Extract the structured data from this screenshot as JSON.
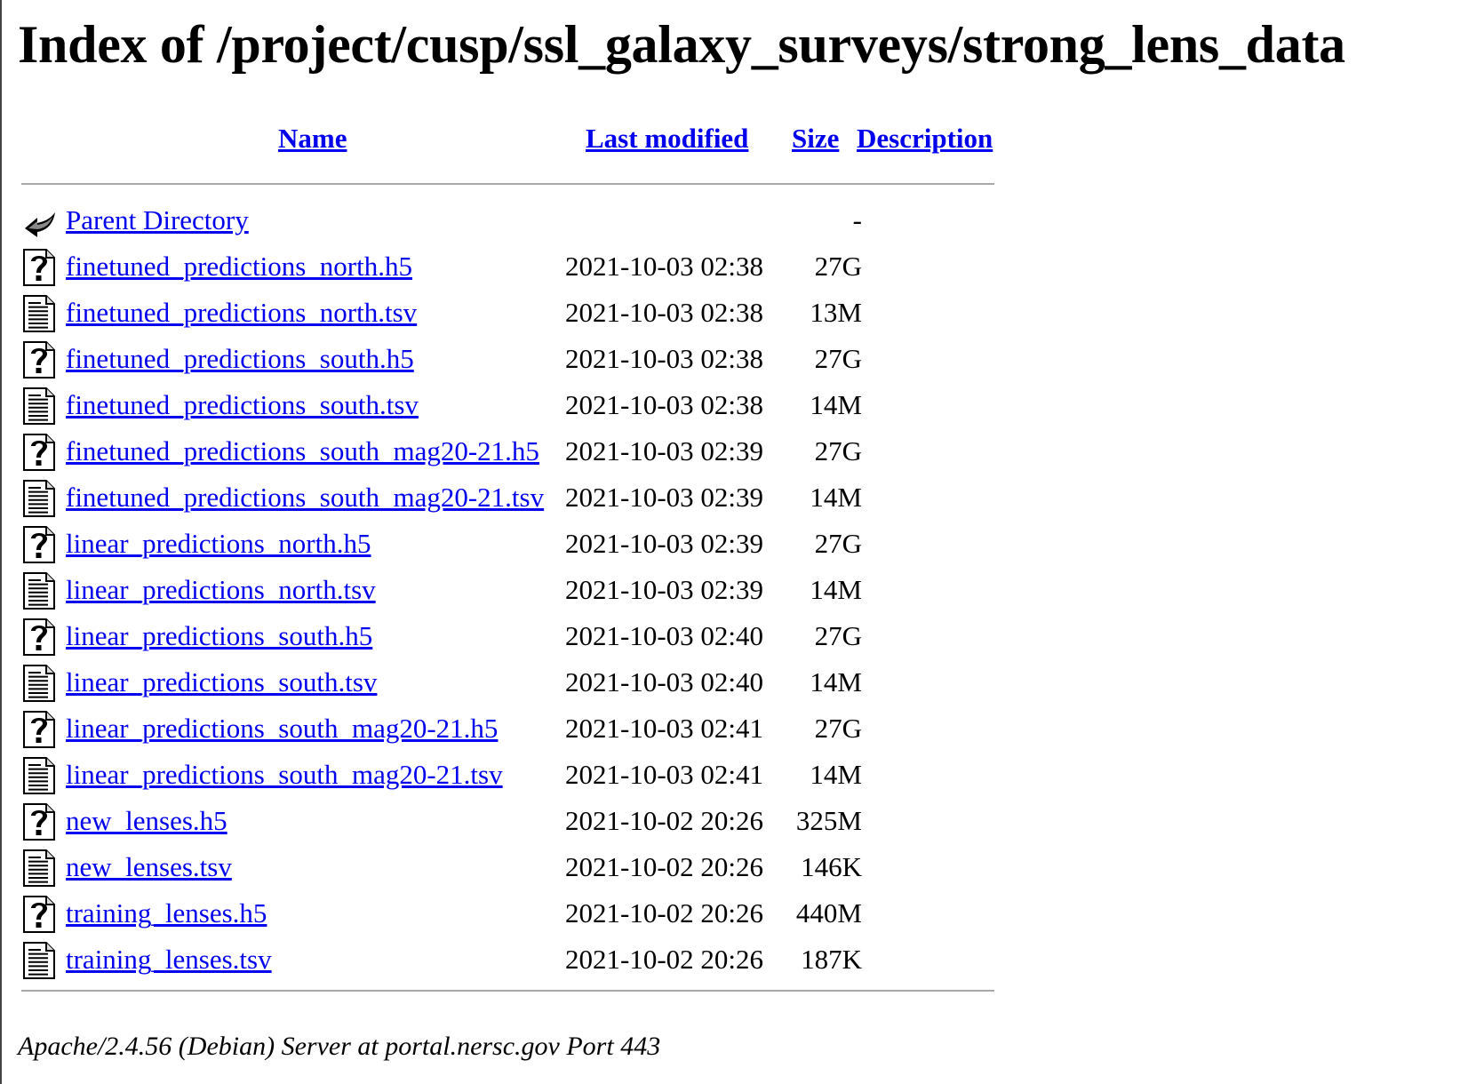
{
  "page": {
    "title": "Index of /project/cusp/ssl_galaxy_surveys/strong_lens_data"
  },
  "columns": {
    "name": "Name",
    "last_modified": "Last modified",
    "size": "Size",
    "description": "Description"
  },
  "entries": [
    {
      "name": "Parent Directory",
      "date": "",
      "size": "-",
      "icon": "back-icon"
    },
    {
      "name": "finetuned_predictions_north.h5",
      "date": "2021-10-03 02:38",
      "size": "27G",
      "icon": "unknown-file-icon"
    },
    {
      "name": "finetuned_predictions_north.tsv",
      "date": "2021-10-03 02:38",
      "size": "13M",
      "icon": "text-file-icon"
    },
    {
      "name": "finetuned_predictions_south.h5",
      "date": "2021-10-03 02:38",
      "size": "27G",
      "icon": "unknown-file-icon"
    },
    {
      "name": "finetuned_predictions_south.tsv",
      "date": "2021-10-03 02:38",
      "size": "14M",
      "icon": "text-file-icon"
    },
    {
      "name": "finetuned_predictions_south_mag20-21.h5",
      "date": "2021-10-03 02:39",
      "size": "27G",
      "icon": "unknown-file-icon"
    },
    {
      "name": "finetuned_predictions_south_mag20-21.tsv",
      "date": "2021-10-03 02:39",
      "size": "14M",
      "icon": "text-file-icon"
    },
    {
      "name": "linear_predictions_north.h5",
      "date": "2021-10-03 02:39",
      "size": "27G",
      "icon": "unknown-file-icon"
    },
    {
      "name": "linear_predictions_north.tsv",
      "date": "2021-10-03 02:39",
      "size": "14M",
      "icon": "text-file-icon"
    },
    {
      "name": "linear_predictions_south.h5",
      "date": "2021-10-03 02:40",
      "size": "27G",
      "icon": "unknown-file-icon"
    },
    {
      "name": "linear_predictions_south.tsv",
      "date": "2021-10-03 02:40",
      "size": "14M",
      "icon": "text-file-icon"
    },
    {
      "name": "linear_predictions_south_mag20-21.h5",
      "date": "2021-10-03 02:41",
      "size": "27G",
      "icon": "unknown-file-icon"
    },
    {
      "name": "linear_predictions_south_mag20-21.tsv",
      "date": "2021-10-03 02:41",
      "size": "14M",
      "icon": "text-file-icon"
    },
    {
      "name": "new_lenses.h5",
      "date": "2021-10-02 20:26",
      "size": "325M",
      "icon": "unknown-file-icon"
    },
    {
      "name": "new_lenses.tsv",
      "date": "2021-10-02 20:26",
      "size": "146K",
      "icon": "text-file-icon"
    },
    {
      "name": "training_lenses.h5",
      "date": "2021-10-02 20:26",
      "size": "440M",
      "icon": "unknown-file-icon"
    },
    {
      "name": "training_lenses.tsv",
      "date": "2021-10-02 20:26",
      "size": "187K",
      "icon": "text-file-icon"
    }
  ],
  "footer": {
    "server_signature": "Apache/2.4.56 (Debian) Server at portal.nersc.gov Port 443"
  },
  "colors": {
    "link": "#0000ee",
    "text": "#000000",
    "rule": "#a8a8a8"
  }
}
